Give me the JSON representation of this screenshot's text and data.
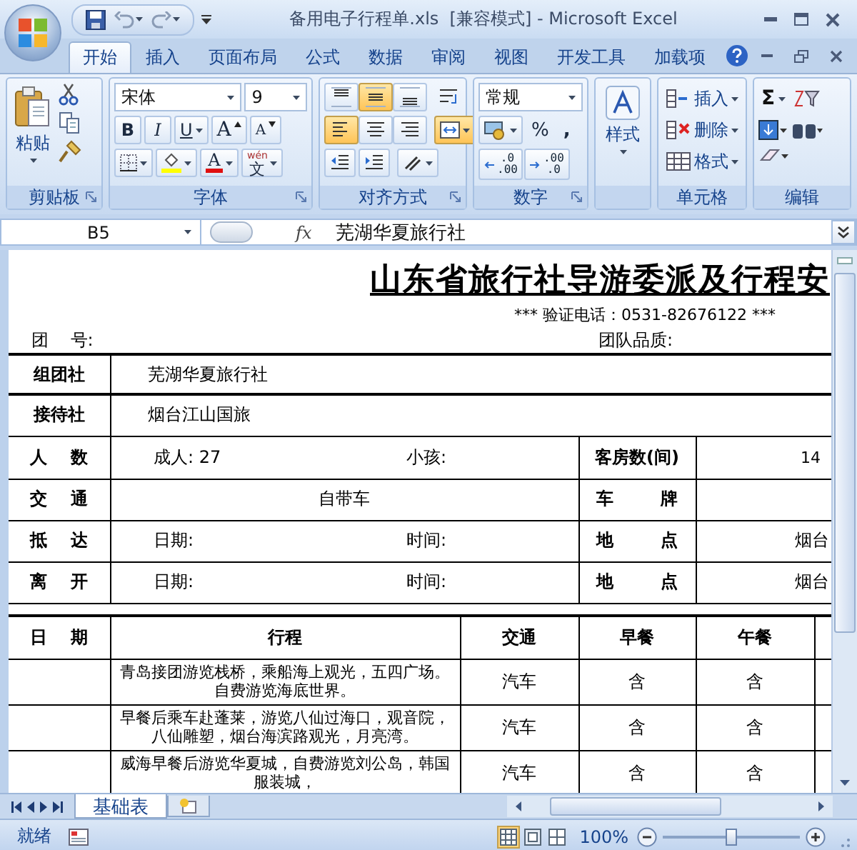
{
  "window": {
    "title": "备用电子行程单.xls  [兼容模式] - Microsoft Excel"
  },
  "tabs": [
    {
      "label": "开始",
      "selected": true
    },
    {
      "label": "插入",
      "selected": false
    },
    {
      "label": "页面布局",
      "selected": false
    },
    {
      "label": "公式",
      "selected": false
    },
    {
      "label": "数据",
      "selected": false
    },
    {
      "label": "审阅",
      "selected": false
    },
    {
      "label": "视图",
      "selected": false
    },
    {
      "label": "开发工具",
      "selected": false
    },
    {
      "label": "加载项",
      "selected": false
    }
  ],
  "ribbon": {
    "clipboard": {
      "label": "剪贴板",
      "paste": "粘贴"
    },
    "font": {
      "label": "字体",
      "font_name": "宋体",
      "font_size": "9",
      "bold": "B",
      "italic": "I",
      "underline": "U",
      "grow": "A",
      "shrink": "A",
      "font_color": "A",
      "phonetic_pinyin": "wén",
      "phonetic_char": "文"
    },
    "alignment": {
      "label": "对齐方式",
      "vertical": [
        {
          "kind": "top",
          "selected": false
        },
        {
          "kind": "middle",
          "selected": true
        },
        {
          "kind": "bottom",
          "selected": false
        }
      ],
      "horizontal": [
        {
          "kind": "left",
          "selected": true
        },
        {
          "kind": "center",
          "selected": false
        },
        {
          "kind": "right",
          "selected": false
        }
      ],
      "merge": {
        "selected": true
      }
    },
    "number": {
      "label": "数字",
      "format": "常规",
      "percent": "%",
      "comma": ",",
      "decimals": [
        {
          "kind": "increase",
          "upper": ".0",
          "lower": ".00"
        },
        {
          "kind": "decrease",
          "upper": ".00",
          "lower": ".0"
        }
      ]
    },
    "styles": {
      "button": "样式"
    },
    "cells": {
      "label": "单元格",
      "buttons": [
        {
          "kind": "insert",
          "label": "插入"
        },
        {
          "kind": "delete",
          "label": "删除"
        },
        {
          "kind": "format",
          "label": "格式"
        }
      ]
    },
    "editing": {
      "label": "编辑",
      "sum": "Σ"
    }
  },
  "formula_bar": {
    "name_box": "B5",
    "fx": "fx",
    "content": "芜湖华夏旅行社"
  },
  "sheet": {
    "title": "山东省旅行社导游委派及行程安",
    "phone": "*** 验证电话：0531-82676122 ***",
    "group_no_label": "团    号:",
    "quality_label": "团队品质:",
    "agencies": [
      {
        "label": "组团社",
        "value": "芜湖华夏旅行社"
      },
      {
        "label": "接待社",
        "value": "烟台江山国旅"
      }
    ],
    "headcount": {
      "label": "人    数",
      "adults_label": "成人:",
      "adults": "27",
      "children_label": "小孩:",
      "rooms_label": "客房数(间)",
      "rooms": "14"
    },
    "transport": {
      "label": "交    通",
      "value": "自带车",
      "plate_label": "车        牌"
    },
    "movements": [
      {
        "label": "抵    达",
        "date_label": "日期:",
        "time_label": "时间:",
        "place_label": "地        点",
        "place": "烟台"
      },
      {
        "label": "离    开",
        "date_label": "日期:",
        "time_label": "时间:",
        "place_label": "地        点",
        "place": "烟台"
      }
    ],
    "itinerary": {
      "columns": [
        "日    期",
        "行程",
        "交通",
        "早餐",
        "午餐"
      ],
      "rows": [
        {
          "route": "青岛接团游览栈桥，乘船海上观光，五四广场。自费游览海底世界。",
          "transport": "汽车",
          "breakfast": "含",
          "lunch": "含"
        },
        {
          "route": "早餐后乘车赴蓬莱，游览八仙过海口，观音院，八仙雕塑，烟台海滨路观光，月亮湾。",
          "transport": "汽车",
          "breakfast": "含",
          "lunch": "含"
        },
        {
          "route": "威海早餐后游览华夏城，自费游览刘公岛，韩国服装城，",
          "transport": "汽车",
          "breakfast": "含",
          "lunch": "含"
        }
      ]
    }
  },
  "sheet_tabs": [
    {
      "label": "基础表",
      "selected": true
    }
  ],
  "status_bar": {
    "status": "就绪",
    "views": [
      {
        "kind": "normal",
        "selected": true
      },
      {
        "kind": "page_layout",
        "selected": false
      },
      {
        "kind": "page_break",
        "selected": false
      }
    ],
    "zoom": {
      "label": "100%",
      "level": 0.5
    }
  }
}
